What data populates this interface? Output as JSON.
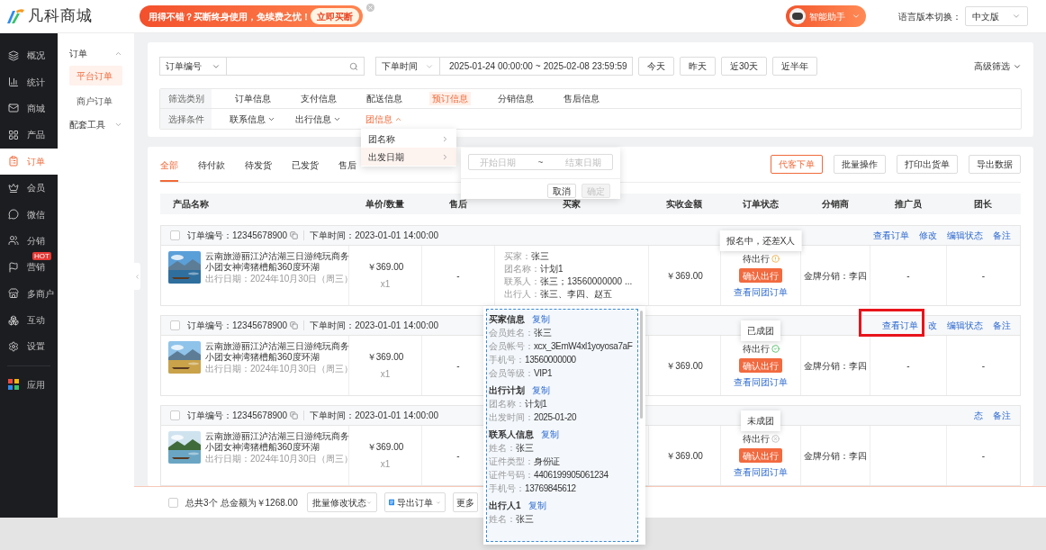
{
  "brand": {
    "name": "凡科商城"
  },
  "promo": {
    "text": "用得不错？买断终身使用，免续费之忧！",
    "button": "立即买断"
  },
  "assistant": {
    "label": "智能助手"
  },
  "language": {
    "label": "语言版本切换：",
    "value": "中文版"
  },
  "nav": [
    {
      "label": "概况",
      "selected": false
    },
    {
      "label": "统计",
      "selected": false
    },
    {
      "label": "商城",
      "selected": false
    },
    {
      "label": "产品",
      "selected": false
    },
    {
      "label": "订单",
      "selected": true
    },
    {
      "label": "会员",
      "selected": false
    },
    {
      "label": "微信",
      "selected": false
    },
    {
      "label": "分销",
      "selected": false
    },
    {
      "label": "营销",
      "selected": false,
      "badge": "HOT"
    },
    {
      "label": "多商户",
      "selected": false
    },
    {
      "label": "互动",
      "selected": false
    },
    {
      "label": "设置",
      "selected": false
    }
  ],
  "nav_bottom": [
    {
      "label": "应用",
      "selected": false
    }
  ],
  "subnav": [
    {
      "label": "订单",
      "expanded": true,
      "children": [
        {
          "label": "平台订单",
          "selected": true
        },
        {
          "label": "商户订单",
          "selected": false
        }
      ]
    },
    {
      "label": "配套工具",
      "expanded": false
    }
  ],
  "search": {
    "field": "订单编号",
    "time_field": "下单时间",
    "start": "2025-01-24 00:00:00",
    "separator": "~",
    "end": "2025-02-08 23:59:59",
    "quick": [
      "今天",
      "昨天",
      "近30天",
      "近半年"
    ],
    "advanced": "高级筛选"
  },
  "filter": {
    "category_label": "筛选类别",
    "categories": [
      {
        "label": "订单信息",
        "selected": false
      },
      {
        "label": "支付信息",
        "selected": false
      },
      {
        "label": "配送信息",
        "selected": false
      },
      {
        "label": "预订信息",
        "selected": true
      },
      {
        "label": "分销信息",
        "selected": false
      },
      {
        "label": "售后信息",
        "selected": false
      }
    ],
    "condition_label": "选择条件",
    "conditions": [
      {
        "label": "联系信息",
        "expanded": false
      },
      {
        "label": "出行信息",
        "expanded": false
      },
      {
        "label": "团信息",
        "expanded": true
      }
    ]
  },
  "condition_menu": [
    {
      "label": "团名称",
      "selected": false
    },
    {
      "label": "出发日期",
      "selected": true
    }
  ],
  "date_popover": {
    "start_placeholder": "开始日期",
    "separator": "~",
    "end_placeholder": "结束日期",
    "cancel": "取消",
    "confirm": "确定",
    "confirm_disabled": true
  },
  "tabs": [
    {
      "label": "全部",
      "selected": true
    },
    {
      "label": "待付款",
      "selected": false
    },
    {
      "label": "待发货",
      "selected": false
    },
    {
      "label": "已发货",
      "selected": false
    },
    {
      "label": "售后",
      "selected": false
    }
  ],
  "actions": [
    {
      "label": "代客下单",
      "primary": true
    },
    {
      "label": "批量操作",
      "primary": false
    },
    {
      "label": "打印出货单",
      "primary": false
    },
    {
      "label": "导出数据",
      "primary": false
    }
  ],
  "table": {
    "columns": [
      "产品名称",
      "单价/数量",
      "售后",
      "买家",
      "实收金额",
      "订单状态",
      "分销商",
      "推广员",
      "团长"
    ],
    "orders": [
      {
        "checked": false,
        "order_no_label": "订单编号：",
        "order_no": "12345678900",
        "time_label": "下单时间：",
        "time": "2023-01-01 14:00:00",
        "product": "云南旅游丽江泸沽湖三日游纯玩商务小团女神湾猪槽船360度环湖",
        "travel_date": "出行日期：2024年10月30日（周三）",
        "price": "￥369.00",
        "qty": "x1",
        "after_sale": "-",
        "buyer": [
          {
            "label": "买家：",
            "value": "张三"
          },
          {
            "label": "团名称：",
            "value": "计划1"
          },
          {
            "label": "联系人：",
            "value": "张三；13560000000 ..."
          },
          {
            "label": "出行人：",
            "value": "张三、李四、赵五"
          }
        ],
        "amount": "￥369.00",
        "status": "待出行",
        "kind": "pending",
        "confirm": "确认出行",
        "group_link": "查看同团订单",
        "distributor": "金牌分销：李四",
        "promoter": "-",
        "leader": "-",
        "tooltip": "报名中，还差X人",
        "actions": [
          "查看订单",
          "修改",
          "编辑状态",
          "备注"
        ]
      },
      {
        "checked": false,
        "order_no_label": "订单编号：",
        "order_no": "12345678900",
        "time_label": "下单时间：",
        "time": "2023-01-01 14:00:00",
        "product": "云南旅游丽江泸沽湖三日游纯玩商务小团女神湾猪槽船360度环湖",
        "travel_date": "出行日期：2024年10月30日（周三）",
        "price": "￥369.00",
        "qty": "x1",
        "after_sale": "-",
        "amount": "￥369.00",
        "status": "待出行",
        "kind": "formed",
        "confirm": "确认出行",
        "group_link": "查看同团订单",
        "distributor": "金牌分销：李四",
        "promoter": "-",
        "leader": "-",
        "tooltip": "已成团",
        "actions": [
          "查看订单",
          "改",
          "编辑状态",
          "备注"
        ]
      },
      {
        "checked": false,
        "order_no_label": "订单编号：",
        "order_no": "12345678900",
        "time_label": "下单时间：",
        "time": "2023-01-01 14:00:00",
        "product": "云南旅游丽江泸沽湖三日游纯玩商务小团女神湾猪槽船360度环湖",
        "travel_date": "出行日期：2024年10月30日（周三）",
        "price": "￥369.00",
        "qty": "x1",
        "after_sale": "-",
        "amount": "￥369.00",
        "status": "待出行",
        "kind": "failed",
        "confirm": "确认出行",
        "group_link": "查看同团订单",
        "distributor": "金牌分销：李四",
        "leader": "-",
        "tooltip": "未成团",
        "actions": [
          "态",
          "备注"
        ]
      }
    ]
  },
  "buyer_popup": [
    {
      "title": "买家信息",
      "copy": "复制",
      "fields": [
        {
          "label": "会员姓名：",
          "value": "张三"
        },
        {
          "label": "会员帐号：",
          "value": "xcx_3EmW4xl1yoyosa7aF"
        },
        {
          "label": "手机号：",
          "value": "13560000000"
        },
        {
          "label": "会员等级：",
          "value": "VIP1"
        }
      ]
    },
    {
      "title": "出行计划",
      "copy": "复制",
      "fields": [
        {
          "label": "团名称：",
          "value": "计划1"
        },
        {
          "label": "出发时间：",
          "value": "2025-01-20"
        }
      ]
    },
    {
      "title": "联系人信息",
      "copy": "复制",
      "fields": [
        {
          "label": "姓名：",
          "value": "张三"
        },
        {
          "label": "证件类型：",
          "value": "身份证"
        },
        {
          "label": "证件号码：",
          "value": "4406199905061234"
        },
        {
          "label": "手机号：",
          "value": "13769845612"
        }
      ]
    },
    {
      "title": "出行人1",
      "copy": "复制",
      "fields": [
        {
          "label": "姓名：",
          "value": "张三"
        }
      ]
    }
  ],
  "footer": {
    "checked": false,
    "count": "总共3个",
    "total": "总金额为￥1268.00",
    "batch": "批量修改状态",
    "export": "导出订单",
    "more": "更多"
  }
}
